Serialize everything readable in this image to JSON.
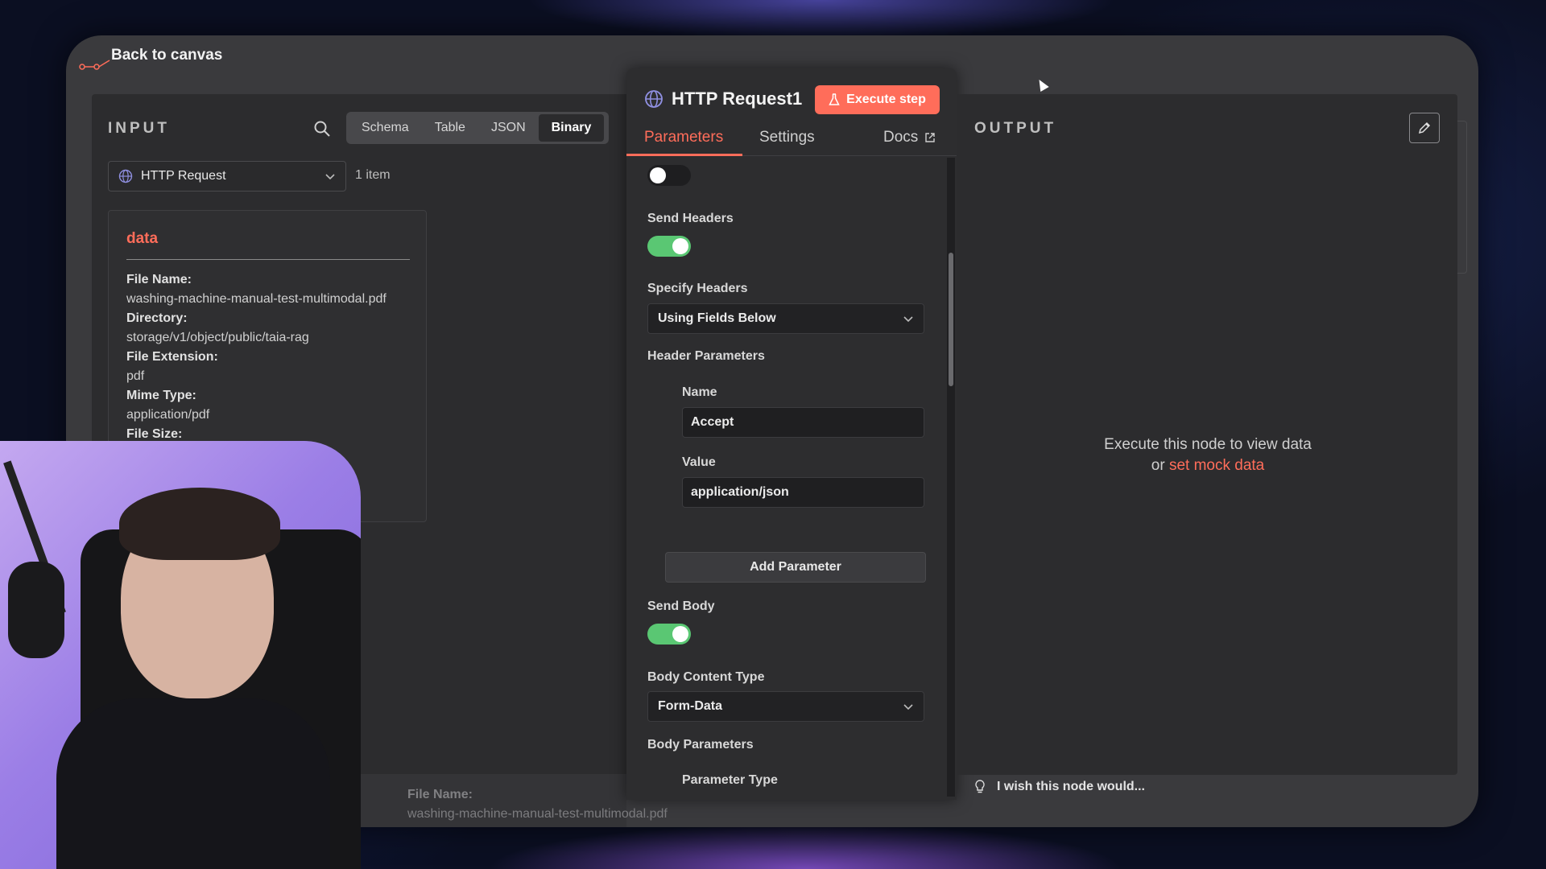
{
  "header": {
    "back_label": "Back to canvas"
  },
  "input": {
    "label": "INPUT",
    "view_tabs": [
      "Schema",
      "Table",
      "JSON",
      "Binary"
    ],
    "active_view": "Binary",
    "node_select": "HTTP Request",
    "item_count": "1 item",
    "card_title": "data",
    "fields": [
      {
        "key": "File Name:",
        "value": "washing-machine-manual-test-multimodal.pdf"
      },
      {
        "key": "Directory:",
        "value": "storage/v1/object/public/taia-rag"
      },
      {
        "key": "File Extension:",
        "value": "pdf"
      },
      {
        "key": "Mime Type:",
        "value": "application/pdf"
      },
      {
        "key": "File Size:",
        "value": ""
      }
    ],
    "bottom_file": {
      "key": "File Name:",
      "value": "washing-machine-manual-test-multimodal.pdf"
    }
  },
  "node": {
    "title": "HTTP Request1",
    "execute_label": "Execute step",
    "tabs": {
      "parameters": "Parameters",
      "settings": "Settings",
      "docs": "Docs"
    },
    "send_headers_label": "Send Headers",
    "send_headers": true,
    "specify_headers_label": "Specify Headers",
    "specify_headers_value": "Using Fields Below",
    "header_parameters_label": "Header Parameters",
    "header_name_label": "Name",
    "header_name_value": "Accept",
    "header_value_label": "Value",
    "header_value_value": "application/json",
    "add_parameter_label": "Add Parameter",
    "send_body_label": "Send Body",
    "send_body": true,
    "body_content_type_label": "Body Content Type",
    "body_content_type_value": "Form-Data",
    "body_parameters_label": "Body Parameters",
    "parameter_type_label": "Parameter Type"
  },
  "output": {
    "label": "OUTPUT",
    "empty_line1": "Execute this node to view data",
    "empty_or": "or",
    "empty_link": "set mock data",
    "wish_label": "I wish this node would..."
  },
  "colors": {
    "accent": "#ff6d5a",
    "toggle_on": "#5ac773",
    "panel": "#2c2c2e"
  }
}
